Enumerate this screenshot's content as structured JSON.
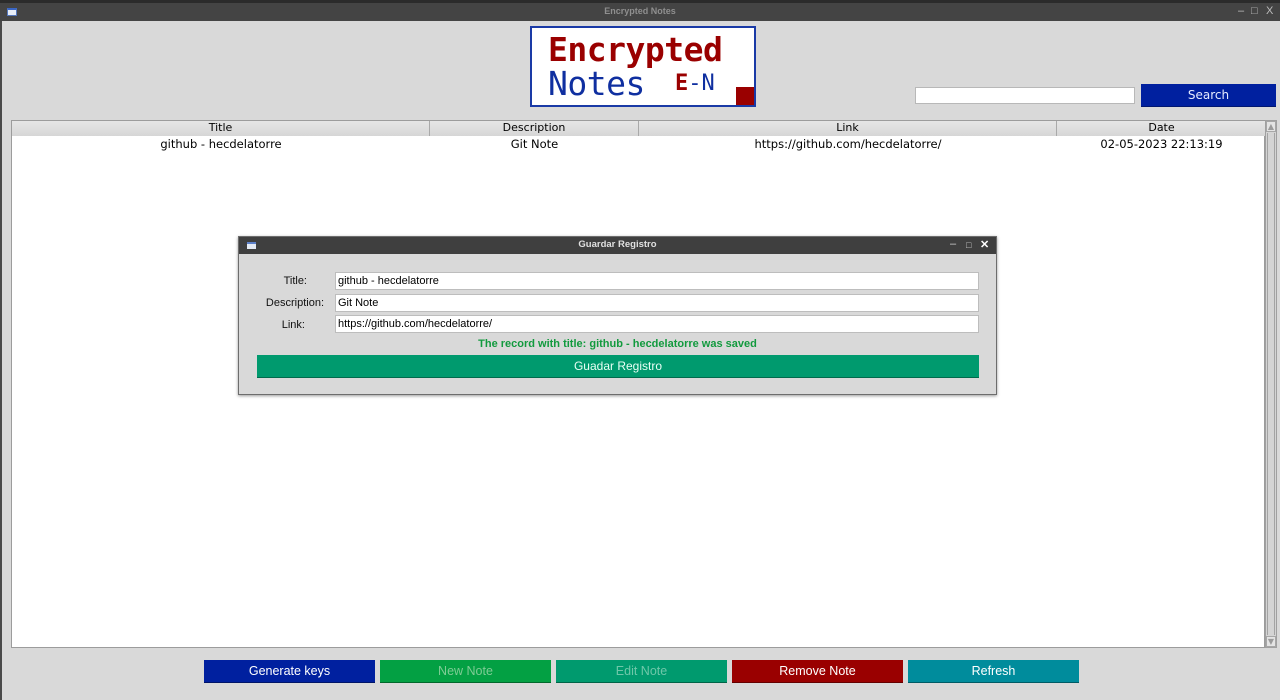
{
  "window": {
    "title": "Encrypted Notes",
    "controls": {
      "minimize": "–",
      "maximize": "□",
      "close": "X"
    }
  },
  "logo": {
    "line1": "Encrypted",
    "line2": "Notes",
    "badge_e": "E",
    "badge_sep": "-",
    "badge_n": "N"
  },
  "search": {
    "value": "",
    "placeholder": "",
    "button_label": "Search"
  },
  "table": {
    "columns": [
      "Title",
      "Description",
      "Link",
      "Date"
    ],
    "rows": [
      [
        "github - hecdelatorre",
        "Git Note",
        "https://github.com/hecdelatorre/",
        "02-05-2023 22:13:19"
      ]
    ]
  },
  "scrollbar": {
    "up": "▲",
    "down": "▼"
  },
  "actions": [
    {
      "label": "Generate keys",
      "bg": "#00209f",
      "fg": "#ffffff",
      "enabled": true
    },
    {
      "label": "New Note",
      "bg": "#03a043",
      "fg": "#7fcc95",
      "enabled": false
    },
    {
      "label": "Edit Note",
      "bg": "#009a6e",
      "fg": "#6ec7a9",
      "enabled": false
    },
    {
      "label": "Remove Note",
      "bg": "#9a0000",
      "fg": "#ffffff",
      "enabled": true
    },
    {
      "label": "Refresh",
      "bg": "#008c9c",
      "fg": "#ffffff",
      "enabled": true
    }
  ],
  "dialog": {
    "title": "Guardar Registro",
    "controls": {
      "minimize": "–",
      "maximize": "□",
      "close": "✕"
    },
    "fields": [
      {
        "label": "Title:",
        "value": "github - hecdelatorre"
      },
      {
        "label": "Description:",
        "value": "Git Note"
      },
      {
        "label": "Link:",
        "value": "https://github.com/hecdelatorre/"
      }
    ],
    "status_message": "The record with title: github - hecdelatorre was saved",
    "status_color": "#129a3e",
    "save_button": "Guadar Registro"
  }
}
